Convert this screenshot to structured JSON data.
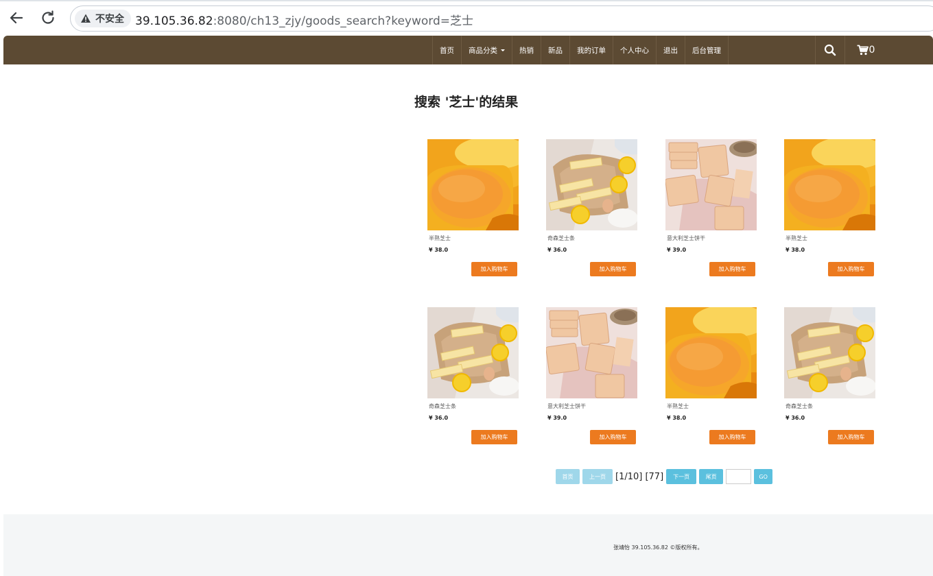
{
  "browser": {
    "security_label": "不安全",
    "url_host": "39.105.36.82",
    "url_path": ":8080/ch13_zjy/goods_search?keyword=芝士"
  },
  "nav": {
    "items": [
      {
        "label": "首页"
      },
      {
        "label": "商品分类"
      },
      {
        "label": "热销"
      },
      {
        "label": "新品"
      },
      {
        "label": "我的订单"
      },
      {
        "label": "个人中心"
      },
      {
        "label": "退出"
      },
      {
        "label": "后台管理"
      }
    ],
    "cart_count": "0"
  },
  "page": {
    "title": "搜索 '芝士'的结果"
  },
  "products": [
    {
      "name": "半熟芝士",
      "price": "¥ 38.0",
      "button": "加入购物车",
      "image": "cheesecake"
    },
    {
      "name": "奇森芝士条",
      "price": "¥ 36.0",
      "button": "加入购物车",
      "image": "cheese-sticks"
    },
    {
      "name": "意大利芝士饼干",
      "price": "¥ 39.0",
      "button": "加入购物车",
      "image": "cheese-crackers"
    },
    {
      "name": "半熟芝士",
      "price": "¥ 38.0",
      "button": "加入购物车",
      "image": "cheesecake"
    },
    {
      "name": "奇森芝士条",
      "price": "¥ 36.0",
      "button": "加入购物车",
      "image": "cheese-sticks"
    },
    {
      "name": "意大利芝士饼干",
      "price": "¥ 39.0",
      "button": "加入购物车",
      "image": "cheese-crackers"
    },
    {
      "name": "半熟芝士",
      "price": "¥ 38.0",
      "button": "加入购物车",
      "image": "cheesecake"
    },
    {
      "name": "奇森芝士条",
      "price": "¥ 36.0",
      "button": "加入购物车",
      "image": "cheese-sticks"
    }
  ],
  "pager": {
    "first": "首页",
    "prev": "上一页",
    "info": "[1/10] [77]",
    "next": "下一页",
    "last": "尾页",
    "go": "GO"
  },
  "footer": {
    "text": "张靖怡 39.105.36.82 ©版权所有。"
  }
}
